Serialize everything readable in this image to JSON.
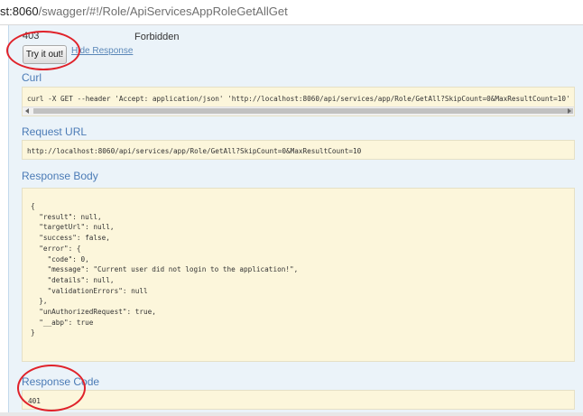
{
  "browser": {
    "url_host": "st:8060",
    "url_path": "/swagger/#!/Role/ApiServicesAppRoleGetAllGet"
  },
  "response_status": {
    "code": "403",
    "text": "Forbidden"
  },
  "actions": {
    "try_it_out": "Try it out!",
    "hide_response": "Hide Response"
  },
  "curl": {
    "heading": "Curl",
    "command": "curl -X GET --header 'Accept: application/json' 'http://localhost:8060/api/services/app/Role/GetAll?SkipCount=0&MaxResultCount=10'"
  },
  "request_url": {
    "heading": "Request URL",
    "value": "http://localhost:8060/api/services/app/Role/GetAll?SkipCount=0&MaxResultCount=10"
  },
  "response_body": {
    "heading": "Response Body",
    "lines": [
      "{",
      "  \"result\": null,",
      "  \"targetUrl\": null,",
      "  \"success\": false,",
      "  \"error\": {",
      "    \"code\": 0,",
      "    \"message\": \"Current user did not login to the application!\",",
      "    \"details\": null,",
      "    \"validationErrors\": null",
      "  },",
      "  \"unAuthorizedRequest\": true,",
      "  \"__abp\": true",
      "}"
    ]
  },
  "response_code": {
    "heading": "Response Code",
    "value": "401"
  },
  "colors": {
    "panel_bg": "#ebf3f9",
    "box_bg": "#fcf6db",
    "heading": "#4b7bb6",
    "annotation": "#e0222a"
  }
}
